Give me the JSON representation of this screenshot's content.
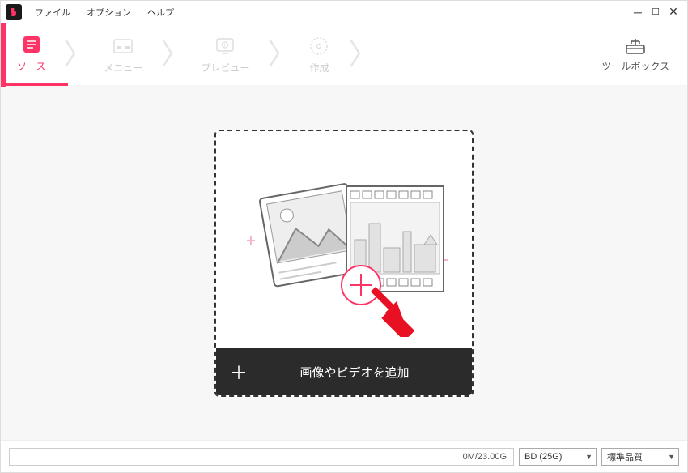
{
  "menubar": {
    "file": "ファイル",
    "options": "オプション",
    "help": "ヘルプ"
  },
  "steps": {
    "source": "ソース",
    "menu": "メニュー",
    "preview": "プレビュー",
    "create": "作成"
  },
  "toolbox": {
    "label": "ツールボックス"
  },
  "dropzone": {
    "add_label": "画像やビデオを追加"
  },
  "status": {
    "progress": "0M/23.00G",
    "disc": "BD (25G)",
    "quality": "標準品質"
  },
  "icons": {
    "search": "search-icon",
    "plus": "plus-icon"
  }
}
